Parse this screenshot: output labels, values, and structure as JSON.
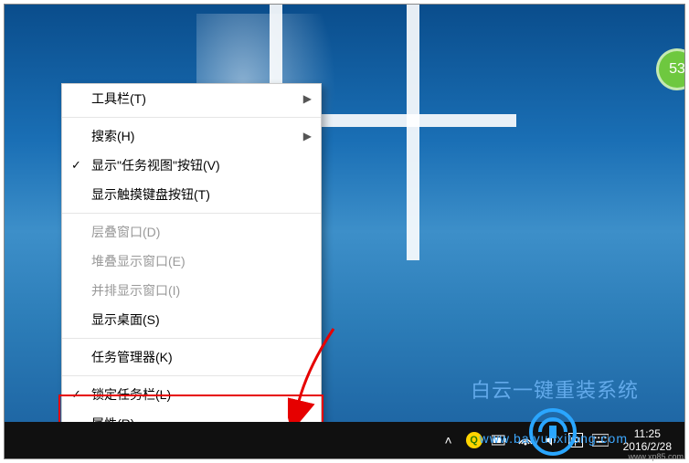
{
  "menu": {
    "items": [
      {
        "label": "工具栏(T)",
        "checked": false,
        "submenu": true,
        "disabled": false
      },
      {
        "sep": true
      },
      {
        "label": "搜索(H)",
        "checked": false,
        "submenu": true,
        "disabled": false
      },
      {
        "label": "显示\"任务视图\"按钮(V)",
        "checked": true,
        "submenu": false,
        "disabled": false
      },
      {
        "label": "显示触摸键盘按钮(T)",
        "checked": false,
        "submenu": false,
        "disabled": false
      },
      {
        "sep": true
      },
      {
        "label": "层叠窗口(D)",
        "checked": false,
        "submenu": false,
        "disabled": true
      },
      {
        "label": "堆叠显示窗口(E)",
        "checked": false,
        "submenu": false,
        "disabled": true
      },
      {
        "label": "并排显示窗口(I)",
        "checked": false,
        "submenu": false,
        "disabled": true
      },
      {
        "label": "显示桌面(S)",
        "checked": false,
        "submenu": false,
        "disabled": false
      },
      {
        "sep": true
      },
      {
        "label": "任务管理器(K)",
        "checked": false,
        "submenu": false,
        "disabled": false
      },
      {
        "sep": true
      },
      {
        "label": "锁定任务栏(L)",
        "checked": true,
        "submenu": false,
        "disabled": false
      },
      {
        "label": "属性(R)",
        "checked": false,
        "submenu": false,
        "disabled": false
      }
    ]
  },
  "badge": {
    "value": "53"
  },
  "clock": {
    "time": "11:25",
    "date": "2016/2/28"
  },
  "watermark": {
    "text": "白云一键重装系统",
    "url": "www.baiyunxitong.com",
    "corner": "www.xp85.com"
  },
  "tray_icons": {
    "chevron": "chevron-up-icon",
    "security": "security-icon",
    "network": "network-icon",
    "volume": "volume-icon",
    "ime": "ime-icon",
    "keyboard": "keyboard-icon",
    "battery": "battery-icon"
  }
}
